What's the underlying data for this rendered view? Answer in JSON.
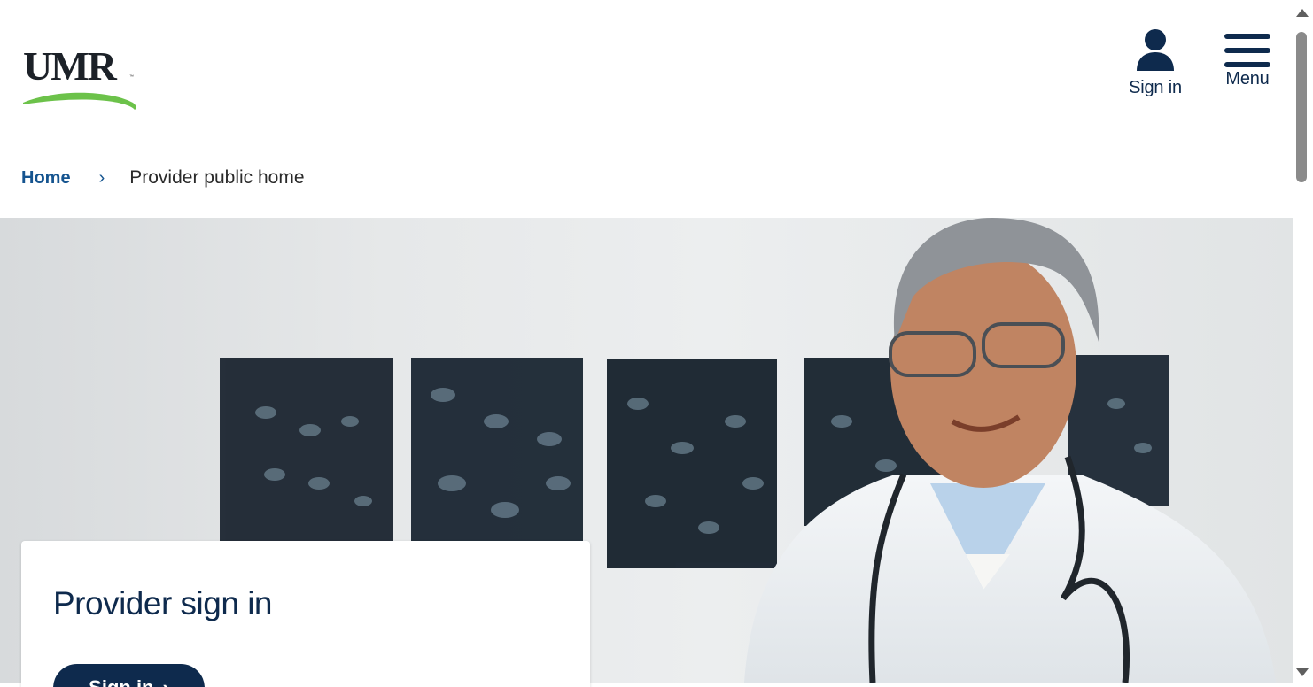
{
  "logo": {
    "wordmark": "UMR",
    "tm": "™",
    "icon": "umr-logo"
  },
  "header": {
    "sign_in_label": "Sign in",
    "sign_in_icon": "person-icon",
    "menu_label": "Menu",
    "menu_icon": "hamburger-menu-icon"
  },
  "breadcrumb": {
    "home": "Home",
    "separator": "›",
    "current": "Provider public home"
  },
  "hero": {
    "image": "doctor-photo-with-xray-films"
  },
  "card": {
    "title": "Provider sign in",
    "button_label": "Sign in",
    "button_icon": "chevron-right-icon"
  },
  "colors": {
    "brand_navy": "#0e2a4d",
    "link_blue": "#15548f",
    "logo_green": "#6cc24a"
  }
}
